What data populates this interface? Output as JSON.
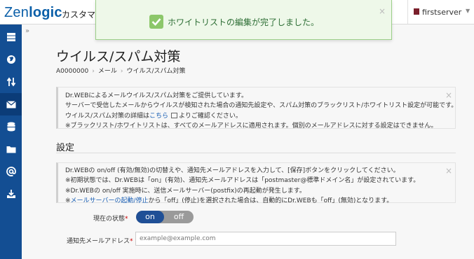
{
  "header": {
    "logo_text_a": "Zen",
    "logo_text_b": "logic",
    "console_title": "カスタマー",
    "user_name": "firstserver",
    "user_caret": "▼"
  },
  "sidebar": {
    "items": [
      {
        "icon": "server-icon"
      },
      {
        "icon": "globe-icon"
      },
      {
        "icon": "transfer-arrows-icon"
      },
      {
        "icon": "mail-icon"
      },
      {
        "icon": "database-icon"
      },
      {
        "icon": "folder-icon"
      },
      {
        "icon": "at-sign-icon"
      },
      {
        "icon": "download-tray-icon"
      }
    ],
    "expand": "»"
  },
  "page": {
    "title": "ウイルス/スパム対策",
    "breadcrumb": [
      "A0000000",
      "メール",
      "ウイルス/スパム対策"
    ],
    "breadcrumb_sep": "›"
  },
  "info1": {
    "line1": "Dr.WEBによるメールウイルス/スパム対策をご提供しています。",
    "line2": "サーバーで受信したメールからウイルスが検知された場合の通知先設定や、スパム対策のブラックリスト/ホワイトリスト設定が可能です。",
    "line3_pre": "ウイルス/スパム対策の詳細は",
    "line3_link": "こちら",
    "line3_post": "よりご確認ください。",
    "line4": "※ブラックリスト/ホワイトリストは、すべてのメールアドレスに適用されます。個別のメールアドレスに対する設定はできません。",
    "close": "×"
  },
  "settings": {
    "heading": "設定",
    "info": {
      "line1": "Dr.WEBの on/off (有効/無効)の切替えや、通知先メールアドレスを入力して、[保存]ボタンをクリックしてください。",
      "line2": "※初期状態では、Dr.WEBは「on」(有効)、通知先メールアドレスは「postmaster@標準ドメイン名」が設定されています。",
      "line3": "※Dr.WEBの on/off 実施時に、送信メールサーバー(postfix)の再起動が発生します。",
      "line4_pre": "※",
      "line4_link": "メールサーバーの起動/停止",
      "line4_post": "から「off」(停止)を選択された場合は、自動的にDr.WEBも「off」(無効)となります。",
      "close": "×"
    },
    "status_label": "現在の状態",
    "required_mark": "*",
    "toggle_on": "on",
    "toggle_off": "off",
    "email_label": "通知先メールアドレス",
    "email_placeholder": "example@example.com",
    "email_value": ""
  },
  "toast": {
    "message": "ホワイトリストの編集が完了しました。",
    "close": "×"
  },
  "colors": {
    "sidebar": "#134e93",
    "accent": "#1f4f96",
    "toast_bg": "#eef8e9",
    "toast_text": "#2d6e35",
    "link": "#1a5fb4"
  }
}
